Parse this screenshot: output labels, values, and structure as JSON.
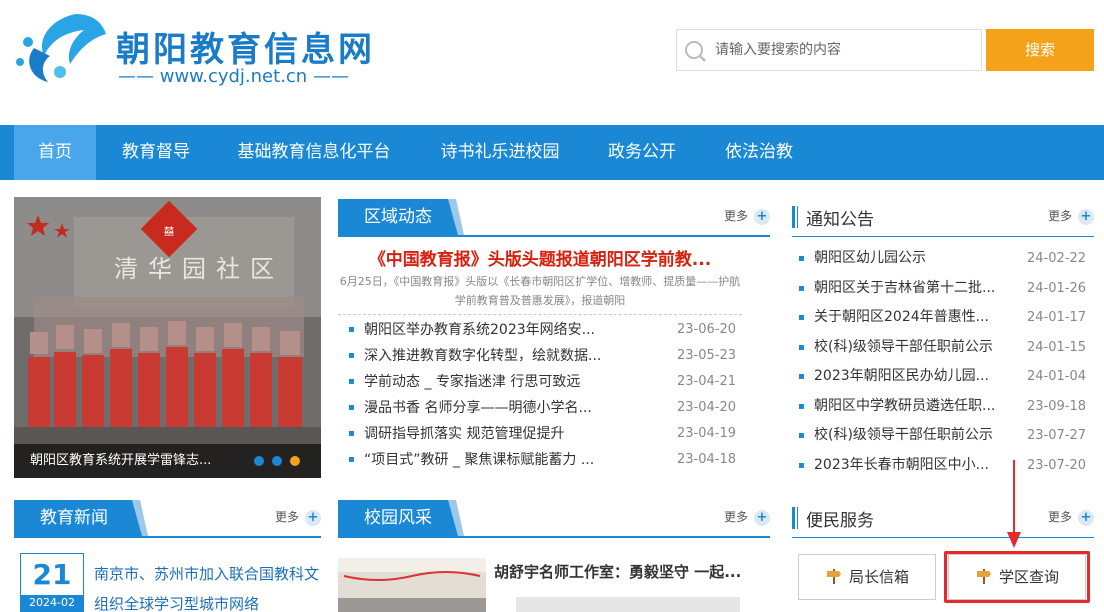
{
  "header": {
    "site_title": "朝阳教育信息网",
    "site_subtitle": "—— www.cydj.net.cn ——",
    "search_placeholder": "请输入要搜索的内容",
    "search_button": "搜索"
  },
  "nav": {
    "items": [
      {
        "label": "首页",
        "active": true
      },
      {
        "label": "教育督导"
      },
      {
        "label": "基础教育信息化平台"
      },
      {
        "label": "诗书礼乐进校园"
      },
      {
        "label": "政务公开"
      },
      {
        "label": "依法治教"
      }
    ]
  },
  "slideshow": {
    "banner_text": "清华园社区",
    "caption": "朝阳区教育系统开展学雷锋志...",
    "dot_colors": [
      "#1b88d6",
      "#1b88d6",
      "#f5a21b"
    ]
  },
  "regional": {
    "tab": "区域动态",
    "more": "更多",
    "headline": "《中国教育报》头版头题报道朝阳区学前教...",
    "summary": "6月25日，《中国教育报》头版以《长春市朝阳区扩学位、增教师、提质量——护航学前教育普及普惠发展》，报道朝阳",
    "items": [
      {
        "title": "朝阳区举办教育系统2023年网络安...",
        "date": "23-06-20"
      },
      {
        "title": "深入推进教育数字化转型，绘就数据...",
        "date": "23-05-23"
      },
      {
        "title": "学前动态 _ 专家指迷津 行思可致远",
        "date": "23-04-21"
      },
      {
        "title": "漫品书香 名师分享——明德小学名...",
        "date": "23-04-20"
      },
      {
        "title": "调研指导抓落实 规范管理促提升",
        "date": "23-04-19"
      },
      {
        "title": "“项目式”教研 _ 聚焦课标赋能蓄力 ...",
        "date": "23-04-18"
      }
    ]
  },
  "notice": {
    "title": "通知公告",
    "more": "更多",
    "items": [
      {
        "title": "朝阳区幼儿园公示",
        "date": "24-02-22"
      },
      {
        "title": "朝阳区关于吉林省第十二批...",
        "date": "24-01-26"
      },
      {
        "title": "关于朝阳区2024年普惠性...",
        "date": "24-01-17"
      },
      {
        "title": "校(科)级领导干部任职前公示",
        "date": "24-01-15"
      },
      {
        "title": "2023年朝阳区民办幼儿园...",
        "date": "24-01-04"
      },
      {
        "title": "朝阳区中学教研员遴选任职...",
        "date": "23-09-18"
      },
      {
        "title": "校(科)级领导干部任职前公示",
        "date": "23-07-27"
      },
      {
        "title": "2023年长春市朝阳区中小...",
        "date": "23-07-20"
      }
    ]
  },
  "edu_news": {
    "tab": "教育新闻",
    "more": "更多",
    "day": "21",
    "year_month": "2024-02",
    "text": "南京市、苏州市加入联合国教科文组织全球学习型城市网络"
  },
  "campus": {
    "tab": "校园风采",
    "more": "更多",
    "title": "胡舒宇名师工作室：勇毅坚守 一起..."
  },
  "service": {
    "title": "便民服务",
    "more": "更多",
    "btn1": "局长信箱",
    "btn2": "学区查询"
  },
  "colors": {
    "brand_blue": "#1b88d6",
    "nav_active": "#4aa6ea",
    "search_orange": "#f5a21b",
    "headline_red": "#d8200f",
    "highlight_red": "#e42a2a"
  }
}
